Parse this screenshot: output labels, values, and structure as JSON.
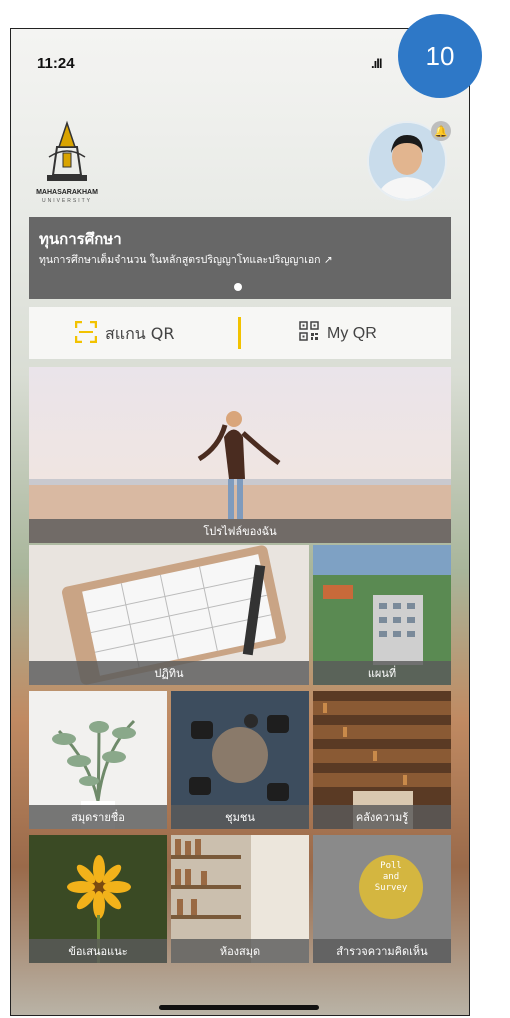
{
  "status": {
    "time": "11:24",
    "signal": ".ıll"
  },
  "badge": "10",
  "logo": {
    "name": "MAHASARAKHAM",
    "sub": "UNIVERSITY"
  },
  "banner": {
    "title": "ทุนการศึกษา",
    "subtitle": "ทุนการศึกษาเต็มจำนวน ในหลักสูตรปริญญาโทและปริญญาเอก"
  },
  "qr": {
    "scan_label": "สแกน QR",
    "myqr_label": "My QR",
    "accent": "#f2c200"
  },
  "tiles": [
    {
      "label": "โปรไฟล์ของฉัน"
    },
    {
      "label": "ปฏิทิน"
    },
    {
      "label": "แผนที่"
    },
    {
      "label": "สมุดรายชื่อ"
    },
    {
      "label": "ชุมชน"
    },
    {
      "label": "คลังความรู้"
    },
    {
      "label": "ข้อเสนอแนะ"
    },
    {
      "label": "ห้องสมุด"
    },
    {
      "label": "สำรวจความคิดเห็น"
    }
  ],
  "poll_text": {
    "line1": "Poll",
    "line2": "and",
    "line3": "Survey"
  }
}
